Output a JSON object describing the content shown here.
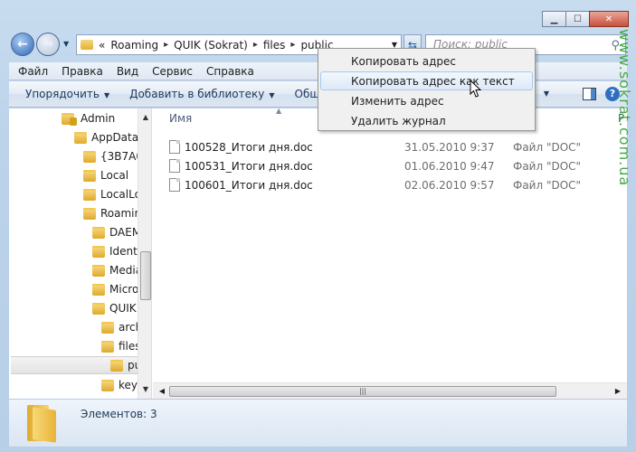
{
  "window": {
    "minimize_glyph": "▁",
    "maximize_glyph": "☐",
    "close_glyph": "✕"
  },
  "address": {
    "overflow": "«",
    "crumbs": [
      "Roaming",
      "QUIK (Sokrat)",
      "files",
      "public"
    ],
    "separator": "▸"
  },
  "search": {
    "placeholder": "Поиск: public"
  },
  "menu": [
    "Файл",
    "Правка",
    "Вид",
    "Сервис",
    "Справка"
  ],
  "toolbar": {
    "organize": "Упорядочить",
    "add_library": "Добавить в библиотеку",
    "share": "Общи"
  },
  "tree": [
    {
      "label": "Admin"
    },
    {
      "label": "AppData"
    },
    {
      "label": "{3B7A0("
    },
    {
      "label": "Local"
    },
    {
      "label": "LocalLo"
    },
    {
      "label": "Roamin"
    },
    {
      "label": "DAEM"
    },
    {
      "label": "Identi"
    },
    {
      "label": "Media"
    },
    {
      "label": "Micro"
    },
    {
      "label": "QUIK"
    },
    {
      "label": "arch"
    },
    {
      "label": "files"
    },
    {
      "label": "pu"
    },
    {
      "label": "key"
    }
  ],
  "columns": {
    "name": "Имя",
    "overflow": "Р"
  },
  "files": [
    {
      "name": "100528_Итоги дня.doc",
      "date": "31.05.2010 9:37",
      "type": "Файл \"DOC\""
    },
    {
      "name": "100531_Итоги дня.doc",
      "date": "01.06.2010 9:47",
      "type": "Файл \"DOC\""
    },
    {
      "name": "100601_Итоги дня.doc",
      "date": "02.06.2010 9:57",
      "type": "Файл \"DOC\""
    }
  ],
  "details": {
    "items_count": "Элементов: 3"
  },
  "context_menu": [
    {
      "label": "Копировать адрес"
    },
    {
      "label": "Копировать адрес как текст"
    },
    {
      "label": "Изменить адрес"
    },
    {
      "label": "Удалить журнал"
    }
  ],
  "watermark": "www.sokrat.com.ua",
  "colors": {
    "watermark": "#3da63d",
    "close_button": "#c8503c",
    "folder": "#e3b134"
  }
}
